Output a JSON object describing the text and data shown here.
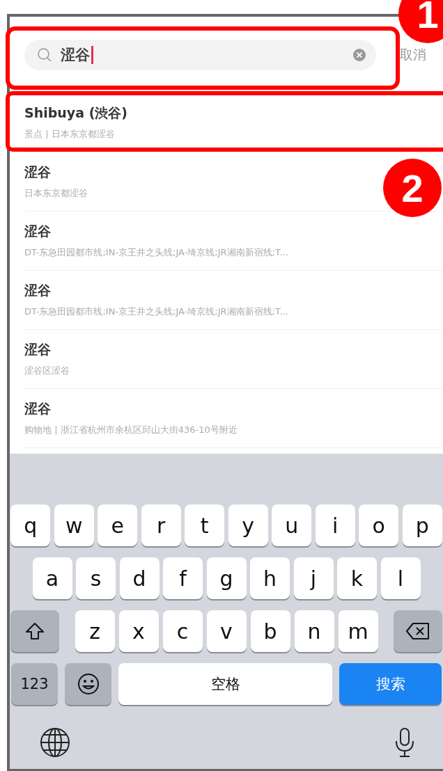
{
  "search": {
    "value": "涩谷",
    "cancel": "取消"
  },
  "results": [
    {
      "title": "Shibuya (渋谷)",
      "subtitle": "景点 | 日本东京都涩谷"
    },
    {
      "title": "涩谷",
      "subtitle": "日本东京都涩谷"
    },
    {
      "title": "涩谷",
      "subtitle": "DT-东急田园都市线;IN-京王井之头线;JA-埼京线;JR湘南新宿线;T..."
    },
    {
      "title": "涩谷",
      "subtitle": "DT-东急田园都市线;IN-京王井之头线;JA-埼京线;JR湘南新宿线;T..."
    },
    {
      "title": "涩谷",
      "subtitle": "涩谷区涩谷"
    },
    {
      "title": "涩谷",
      "subtitle": "购物地 | 浙江省杭州市余杭区邱山大街436-10号附近"
    }
  ],
  "keyboard": {
    "rows": [
      {
        "keys": [
          {
            "kind": "letter",
            "label": "q"
          },
          {
            "kind": "letter",
            "label": "w"
          },
          {
            "kind": "letter",
            "label": "e"
          },
          {
            "kind": "letter",
            "label": "r"
          },
          {
            "kind": "letter",
            "label": "t"
          },
          {
            "kind": "letter",
            "label": "y"
          },
          {
            "kind": "letter",
            "label": "u"
          },
          {
            "kind": "letter",
            "label": "i"
          },
          {
            "kind": "letter",
            "label": "o"
          },
          {
            "kind": "letter",
            "label": "p"
          }
        ]
      },
      {
        "keys": [
          {
            "kind": "letter",
            "label": "a"
          },
          {
            "kind": "letter",
            "label": "s"
          },
          {
            "kind": "letter",
            "label": "d"
          },
          {
            "kind": "letter",
            "label": "f"
          },
          {
            "kind": "letter",
            "label": "g"
          },
          {
            "kind": "letter",
            "label": "h"
          },
          {
            "kind": "letter",
            "label": "j"
          },
          {
            "kind": "letter",
            "label": "k"
          },
          {
            "kind": "letter",
            "label": "l"
          }
        ]
      },
      {
        "keys": [
          {
            "kind": "shift"
          },
          {
            "kind": "letter",
            "label": "z"
          },
          {
            "kind": "letter",
            "label": "x"
          },
          {
            "kind": "letter",
            "label": "c"
          },
          {
            "kind": "letter",
            "label": "v"
          },
          {
            "kind": "letter",
            "label": "b"
          },
          {
            "kind": "letter",
            "label": "n"
          },
          {
            "kind": "letter",
            "label": "m"
          },
          {
            "kind": "backspace"
          }
        ]
      },
      {
        "keys": [
          {
            "kind": "mode",
            "label": "123"
          },
          {
            "kind": "emoji"
          },
          {
            "kind": "space",
            "label": "空格"
          },
          {
            "kind": "action",
            "label": "搜索"
          }
        ]
      }
    ]
  },
  "annotations": [
    {
      "label": "1"
    },
    {
      "label": "2"
    }
  ]
}
